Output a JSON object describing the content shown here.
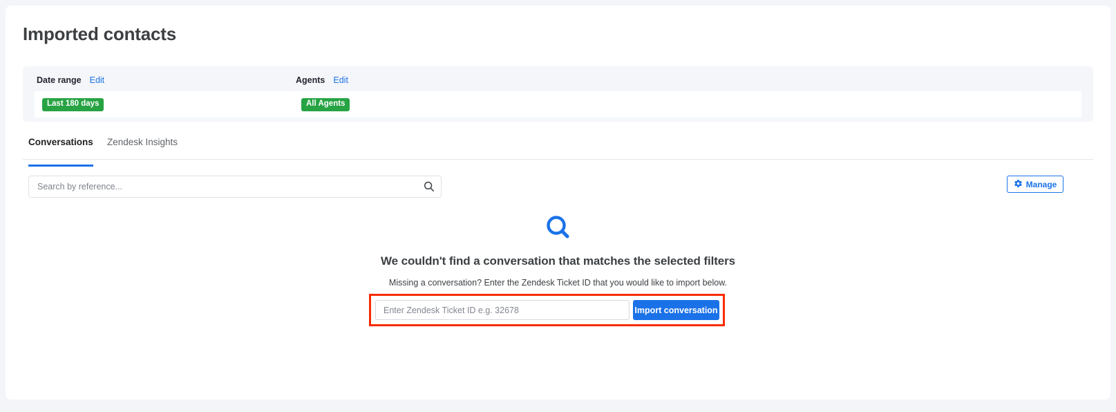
{
  "page": {
    "title": "Imported contacts"
  },
  "filters": {
    "date_range": {
      "label": "Date range",
      "edit_label": "Edit",
      "chip": "Last 180 days",
      "chip_color": "#27a343"
    },
    "agents": {
      "label": "Agents",
      "edit_label": "Edit",
      "chip": "All Agents",
      "chip_color": "#27a343"
    }
  },
  "tabs": [
    {
      "label": "Conversations",
      "active": true
    },
    {
      "label": "Zendesk Insights",
      "active": false
    }
  ],
  "toolbar": {
    "search": {
      "placeholder": "Search by reference...",
      "value": "",
      "icon": "search-icon"
    },
    "manage": {
      "label": "Manage",
      "icon": "gear-icon",
      "accent": "#1a73e8"
    }
  },
  "empty_state": {
    "icon": "search-icon",
    "icon_color": "#1b72e8",
    "title": "We couldn't find a conversation that matches the selected filters",
    "subtitle": "Missing a conversation? Enter the Zendesk Ticket ID that you would like to import below.",
    "import": {
      "placeholder": "Enter Zendesk Ticket ID e.g. 32678",
      "value": "",
      "button_label": "Import conversation",
      "button_color": "#1b72e8",
      "highlight_color": "#f82b00"
    }
  }
}
